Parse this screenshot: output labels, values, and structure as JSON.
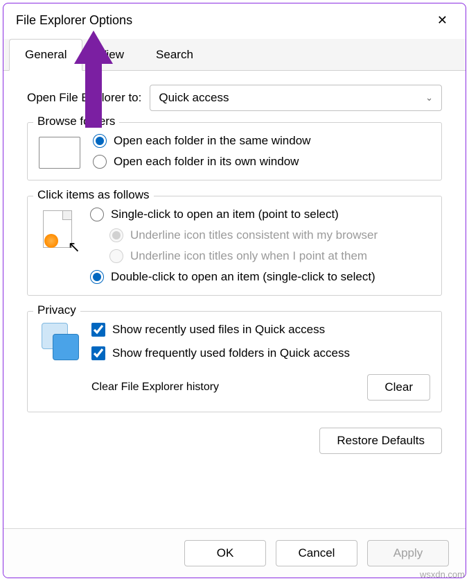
{
  "window": {
    "title": "File Explorer Options"
  },
  "tabs": {
    "general": "General",
    "view": "View",
    "search": "Search",
    "active": "general"
  },
  "open_to": {
    "label": "Open File Explorer to:",
    "value": "Quick access"
  },
  "browse": {
    "legend": "Browse folders",
    "same_window": "Open each folder in the same window",
    "own_window": "Open each folder in its own window"
  },
  "click": {
    "legend": "Click items as follows",
    "single": "Single-click to open an item (point to select)",
    "underline_consistent": "Underline icon titles consistent with my browser",
    "underline_point": "Underline icon titles only when I point at them",
    "double": "Double-click to open an item (single-click to select)"
  },
  "privacy": {
    "legend": "Privacy",
    "recent_files": "Show recently used files in Quick access",
    "freq_folders": "Show frequently used folders in Quick access",
    "clear_label": "Clear File Explorer history",
    "clear_btn": "Clear"
  },
  "restore": "Restore Defaults",
  "footer": {
    "ok": "OK",
    "cancel": "Cancel",
    "apply": "Apply"
  },
  "watermark": "wsxdn.com"
}
